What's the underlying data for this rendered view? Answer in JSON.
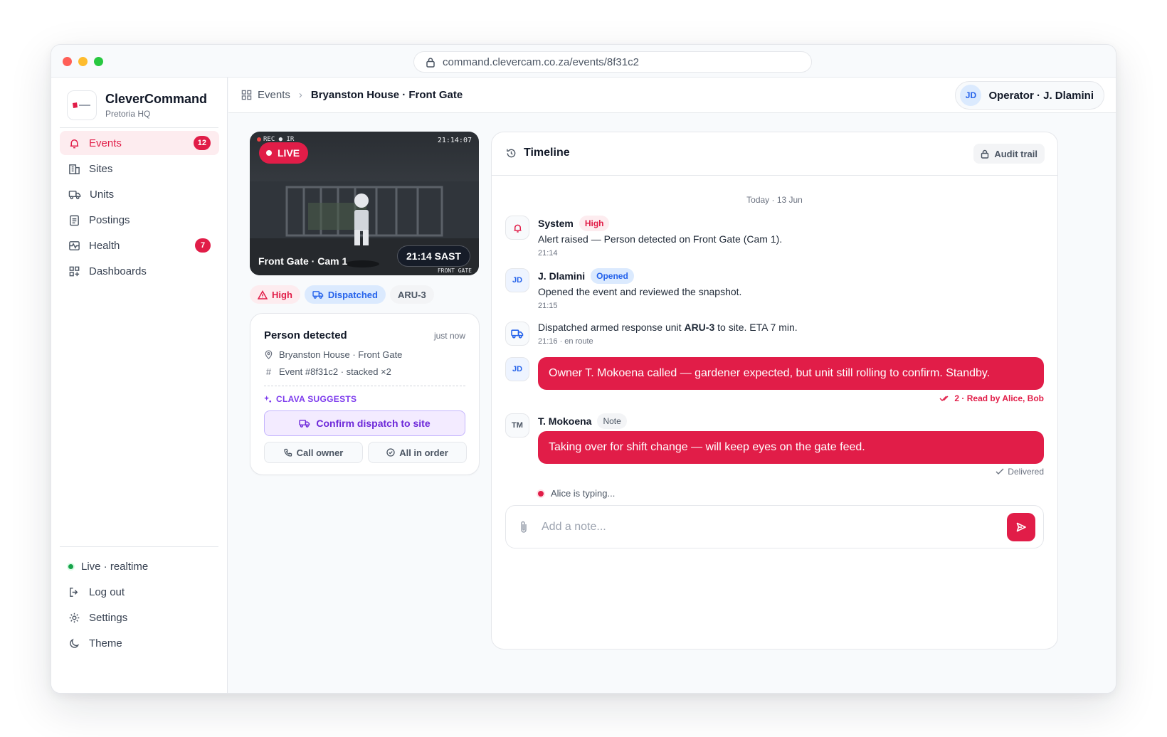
{
  "browser": {
    "url": "command.clevercam.co.za/events/8f31c2"
  },
  "sidebar": {
    "brand": {
      "name": "CleverCommand",
      "subtitle": "Pretoria HQ"
    },
    "items": [
      {
        "label": "Events",
        "icon": "bell-icon",
        "badge": "12",
        "active": true
      },
      {
        "label": "Sites",
        "icon": "building-icon"
      },
      {
        "label": "Units",
        "icon": "truck-icon"
      },
      {
        "label": "Postings",
        "icon": "clipboard-icon"
      },
      {
        "label": "Health",
        "icon": "pulse-icon",
        "badge": "7"
      },
      {
        "label": "Dashboards",
        "icon": "grid-icon"
      }
    ],
    "status": "Live · realtime",
    "footer": [
      {
        "label": "Log out",
        "icon": "logout-icon"
      },
      {
        "label": "Settings",
        "icon": "gear-icon"
      },
      {
        "label": "Theme",
        "icon": "moon-icon"
      }
    ]
  },
  "header": {
    "crumb_root": "Events",
    "crumb_current": "Bryanston House · Front Gate",
    "operator": {
      "initials": "JD",
      "label": "Operator · J. Dlamini"
    }
  },
  "feed": {
    "live": "LIVE",
    "rec": "REC ● IR",
    "time_overlay": "21:14:07",
    "camera": "Front Gate · Cam 1",
    "clock": "21:14 SAST",
    "watermark": "FRONT GATE"
  },
  "tags": {
    "severity": "High",
    "status": "Dispatched",
    "unit": "ARU-3"
  },
  "event_card": {
    "title": "Person detected",
    "time": "just now",
    "location": "Bryanston House · Front Gate",
    "event_id": "Event #8f31c2 · stacked ×2",
    "suggest_label": "CLAVA SUGGESTS",
    "confirm": "Confirm dispatch to site",
    "call": "Call owner",
    "all_in_order": "All in order"
  },
  "timeline": {
    "title": "Timeline",
    "audit": "Audit trail",
    "day": "Today · 13 Jun",
    "events": [
      {
        "actor": "System",
        "chip": "High",
        "text": "Alert raised — Person detected on Front Gate (Cam 1).",
        "time": "21:14"
      },
      {
        "actor": "J. Dlamini",
        "initials": "JD",
        "chip": "Opened",
        "text": "Opened the event and reviewed the snapshot.",
        "time": "21:15"
      },
      {
        "text_before": "Dispatched armed response unit ",
        "text_bold": "ARU-3",
        "text_after": " to site. ETA 7 min.",
        "time": "21:16 · en route"
      },
      {
        "initials": "JD",
        "message": "Owner T. Mokoena called — gardener expected, but unit still rolling to confirm. Standby.",
        "receipt": "2 · Read by Alice, Bob"
      },
      {
        "actor": "T. Mokoena",
        "initials": "TM",
        "chip": "Note",
        "message": "Taking over for shift change — will keep eyes on the gate feed.",
        "receipt": "Delivered"
      }
    ],
    "typing": "Alice is typing...",
    "composer_placeholder": "Add a note..."
  },
  "colors": {
    "accent": "#e11d48",
    "info": "#2563eb",
    "ai": "#7c3aed",
    "live": "#16a34a"
  }
}
